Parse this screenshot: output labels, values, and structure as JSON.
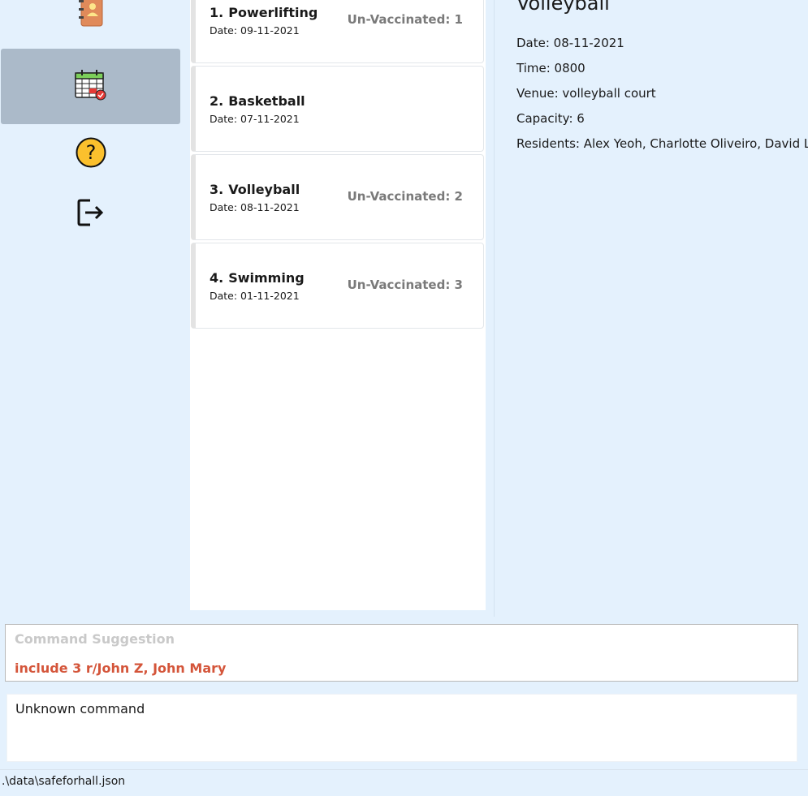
{
  "sidebar": {
    "items": [
      {
        "icon": "address-book-icon",
        "active": false
      },
      {
        "icon": "calendar-icon",
        "active": true
      },
      {
        "icon": "help-icon",
        "active": false
      },
      {
        "icon": "exit-icon",
        "active": false
      }
    ]
  },
  "events": [
    {
      "index": "1.",
      "name": "Powerlifting",
      "date": "Date: 09-11-2021",
      "unvaccinated": "Un-Vaccinated: 1"
    },
    {
      "index": "2.",
      "name": "Basketball",
      "date": "Date: 07-11-2021",
      "unvaccinated": ""
    },
    {
      "index": "3.",
      "name": "Volleyball",
      "date": "Date: 08-11-2021",
      "unvaccinated": "Un-Vaccinated: 2"
    },
    {
      "index": "4.",
      "name": "Swimming",
      "date": "Date: 01-11-2021",
      "unvaccinated": "Un-Vaccinated: 3"
    }
  ],
  "detail": {
    "title": "Volleyball",
    "date": "Date: 08-11-2021",
    "time": "Time: 0800",
    "venue": "Venue: volleyball court",
    "capacity": "Capacity: 6",
    "residents": "Residents: Alex Yeoh, Charlotte Oliveiro, David Li"
  },
  "command": {
    "placeholder": "Command Suggestion",
    "suggestion": "include 3 r/John Z, John Mary"
  },
  "result": {
    "text": "Unknown command"
  },
  "status": {
    "path": ".\\data\\safeforhall.json"
  },
  "colors": {
    "background": "#e4f1fd",
    "active_sidebar": "#abbac9",
    "suggestion_text": "#d4553a"
  }
}
